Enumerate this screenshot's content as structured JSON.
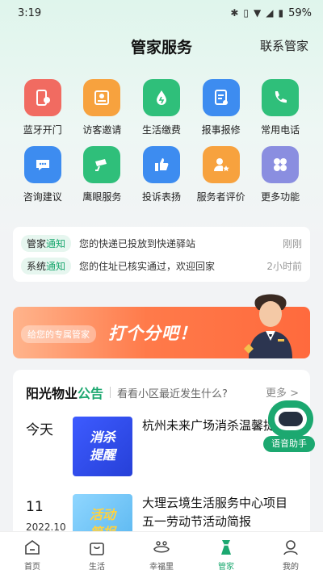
{
  "status_bar": {
    "time": "3:19",
    "battery": "59%"
  },
  "header": {
    "title": "管家服务",
    "contact_link": "联系管家"
  },
  "services": [
    {
      "label": "蓝牙开门",
      "icon": "bluetooth-door-icon",
      "color": "#f16b61"
    },
    {
      "label": "访客邀请",
      "icon": "visitor-invite-icon",
      "color": "#f7a23e"
    },
    {
      "label": "生活缴费",
      "icon": "utility-payment-icon",
      "color": "#2fbf7a"
    },
    {
      "label": "报事报修",
      "icon": "repair-report-icon",
      "color": "#3d8cf0"
    },
    {
      "label": "常用电话",
      "icon": "phone-icon",
      "color": "#2fbf7a"
    },
    {
      "label": "咨询建议",
      "icon": "chat-icon",
      "color": "#3d8cf0"
    },
    {
      "label": "鹰眼服务",
      "icon": "camera-icon",
      "color": "#2fbf7a"
    },
    {
      "label": "投诉表扬",
      "icon": "thumbs-up-icon",
      "color": "#3d8cf0"
    },
    {
      "label": "服务者评价",
      "icon": "rating-icon",
      "color": "#f7a23e"
    },
    {
      "label": "更多功能",
      "icon": "more-icon",
      "color": "#8a8ee0"
    }
  ],
  "notices": [
    {
      "tag_prefix": "管家",
      "tag_suffix": "通知",
      "text": "您的快递已投放到快递驿站",
      "time": "刚刚"
    },
    {
      "tag_prefix": "系统",
      "tag_suffix": "通知",
      "text": "您的住址已核实通过，欢迎回家",
      "time": "2小时前"
    }
  ],
  "banner": {
    "pill": "给您的专属管家",
    "headline": "打个分吧！"
  },
  "news": {
    "title_prefix": "阳光物业",
    "title_suffix": "公告",
    "subtitle": "看看小区最近发生什么?",
    "more": "更多 >",
    "items": [
      {
        "date_big": "今天",
        "date_small": "",
        "thumb_line1": "消杀",
        "thumb_line2": "提醒",
        "text": "杭州未来广场消杀温馨提醒"
      },
      {
        "date_big": "11",
        "date_small": "2022.10",
        "thumb_line1": "活动",
        "thumb_line2": "简报",
        "text": "大理云境生活服务中心项目五一劳动节活动简报"
      }
    ]
  },
  "assistant": {
    "label": "语音助手"
  },
  "colors": {
    "accent": "#1ca870",
    "banner": "#ff7a4a"
  },
  "tabs": [
    {
      "label": "首页",
      "icon": "home-icon",
      "active": false
    },
    {
      "label": "生活",
      "icon": "shopping-bag-icon",
      "active": false
    },
    {
      "label": "幸福里",
      "icon": "community-icon",
      "active": false
    },
    {
      "label": "管家",
      "icon": "butler-icon",
      "active": true
    },
    {
      "label": "我的",
      "icon": "profile-icon",
      "active": false
    }
  ]
}
